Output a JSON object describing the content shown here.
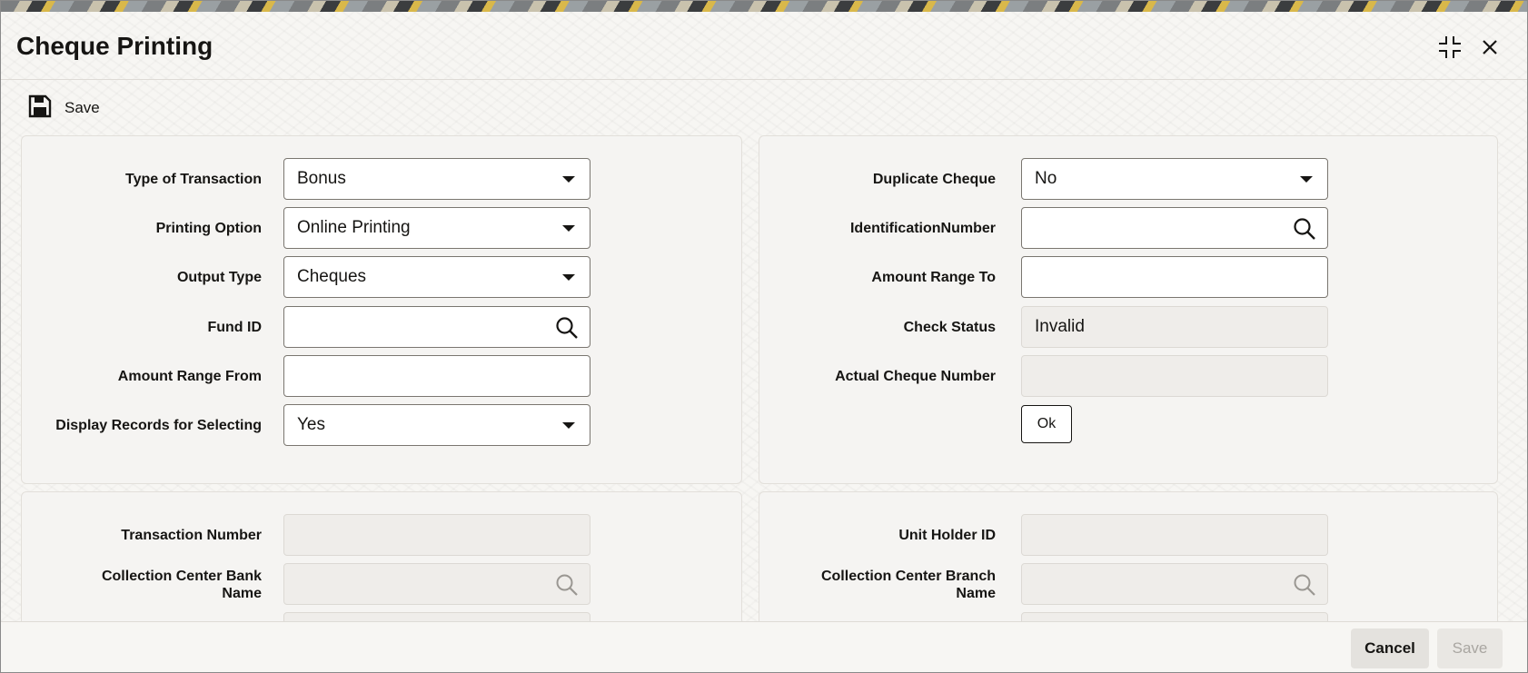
{
  "window": {
    "title": "Cheque Printing"
  },
  "toolbar": {
    "save_label": "Save"
  },
  "form_left": {
    "type_of_transaction": {
      "label": "Type of Transaction",
      "value": "Bonus"
    },
    "printing_option": {
      "label": "Printing Option",
      "value": "Online Printing"
    },
    "output_type": {
      "label": "Output Type",
      "value": "Cheques"
    },
    "fund_id": {
      "label": "Fund ID",
      "value": ""
    },
    "amount_range_from": {
      "label": "Amount Range From",
      "value": ""
    },
    "display_records": {
      "label": "Display Records for Selecting",
      "value": "Yes"
    }
  },
  "form_right": {
    "duplicate_cheque": {
      "label": "Duplicate Cheque",
      "value": "No"
    },
    "identification_number": {
      "label": "IdentificationNumber",
      "value": ""
    },
    "amount_range_to": {
      "label": "Amount Range To",
      "value": ""
    },
    "check_status": {
      "label": "Check Status",
      "value": "Invalid"
    },
    "actual_cheque_number": {
      "label": "Actual Cheque Number",
      "value": ""
    },
    "ok_label": "Ok"
  },
  "details_left": {
    "transaction_number": {
      "label": "Transaction Number",
      "value": ""
    },
    "collection_center_bank_name": {
      "label_line1": "Collection Center Bank",
      "label_line2": "Name",
      "value": ""
    }
  },
  "details_right": {
    "unit_holder_id": {
      "label": "Unit Holder ID",
      "value": ""
    },
    "collection_center_branch_name": {
      "label_line1": "Collection Center Branch",
      "label_line2": "Name",
      "value": ""
    }
  },
  "footer": {
    "cancel_label": "Cancel",
    "save_label": "Save"
  },
  "icons": {
    "maximize": "compress-arrows-icon",
    "close": "close-icon",
    "save": "floppy-disk-icon",
    "search": "magnifier-icon"
  }
}
